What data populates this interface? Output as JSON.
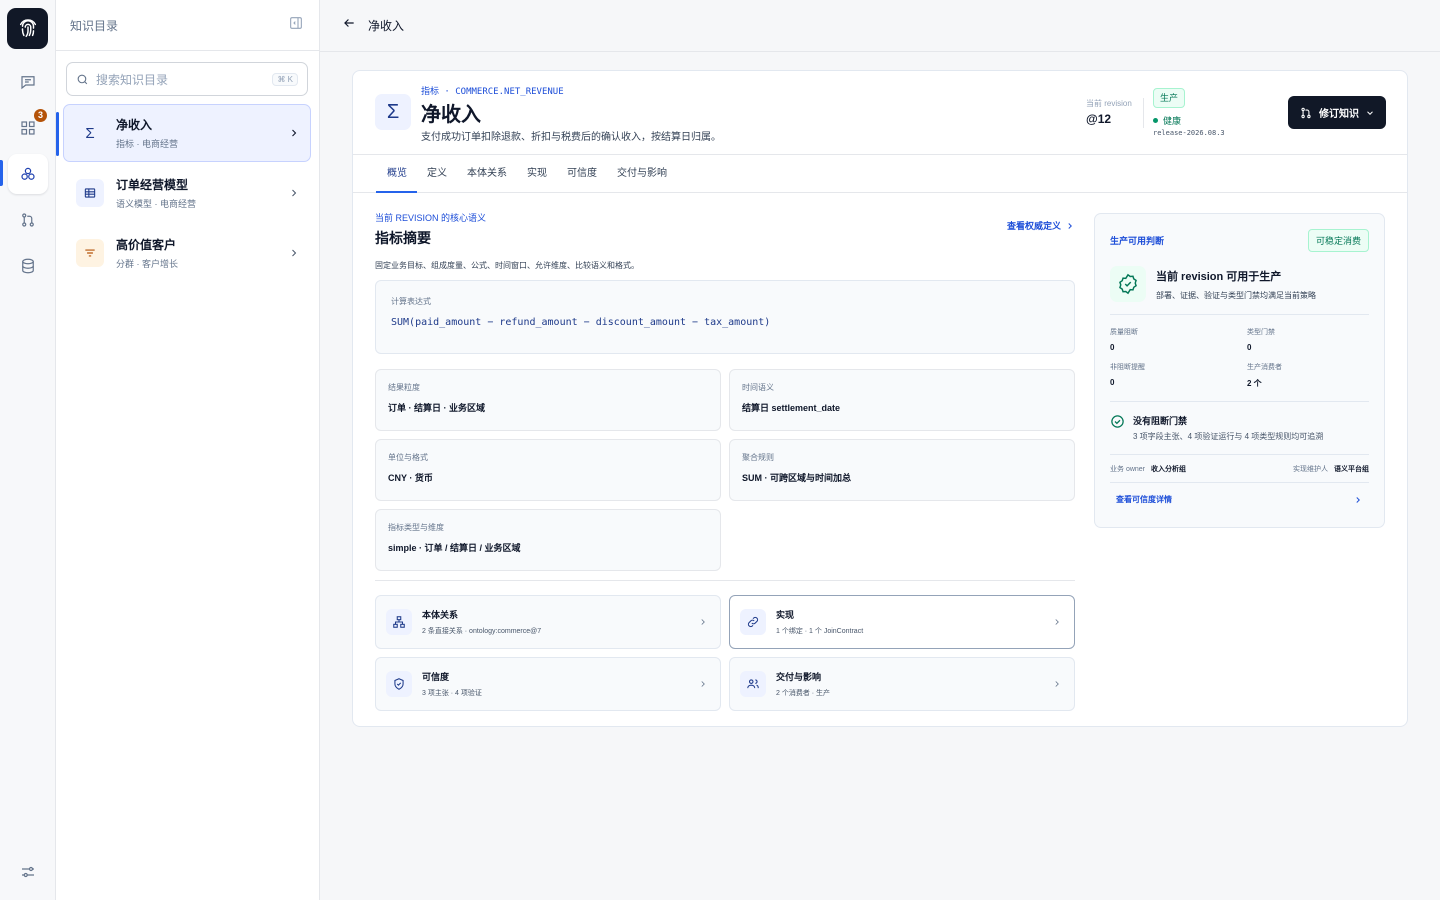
{
  "colors": {
    "accent": "#2563eb",
    "dark": "#111827",
    "success": "#047857",
    "warning": "#b45309"
  },
  "rail": {
    "badge_count": "3",
    "icons": [
      "fingerprint-icon",
      "chat-icon",
      "dashboard-icon",
      "ontology-icon",
      "git-branch-icon",
      "database-icon",
      "settings-sliders-icon"
    ]
  },
  "sidebar": {
    "title": "知识目录",
    "search_placeholder": "搜索知识目录",
    "search_shortcut": "⌘ K",
    "items": [
      {
        "name": "净收入",
        "sub": "指标 · 电商经营",
        "icon": "sigma-icon",
        "active": true
      },
      {
        "name": "订单经营模型",
        "sub": "语义模型 · 电商经营",
        "icon": "table-icon",
        "active": false
      },
      {
        "name": "高价值客户",
        "sub": "分群 · 客户增长",
        "icon": "filter-icon",
        "active": false
      }
    ]
  },
  "topbar": {
    "title": "净收入"
  },
  "header": {
    "eyebrow": "指标 · COMMERCE.NET_REVENUE",
    "title": "净收入",
    "description": "支付成功订单扣除退款、折扣与税费后的确认收入，按结算日归属。",
    "revision_label": "当前 revision",
    "revision_value": "@12",
    "env_pill": "生产",
    "health": "健康",
    "release": "release-2026.08.3",
    "revise_button": "修订知识"
  },
  "tabs": [
    "概览",
    "定义",
    "本体关系",
    "实现",
    "可信度",
    "交付与影响"
  ],
  "summary": {
    "kicker": "当前 REVISION 的核心语义",
    "title": "指标摘要",
    "authority_link": "查看权威定义",
    "description": "固定业务目标、组成度量、公式、时间窗口、允许维度、比较语义和格式。",
    "expression_label": "计算表达式",
    "expression": "SUM(paid_amount − refund_amount − discount_amount − tax_amount)",
    "fields": [
      {
        "label": "结果粒度",
        "value": "订单 · 结算日 · 业务区域"
      },
      {
        "label": "时间语义",
        "value": "结算日 settlement_date"
      },
      {
        "label": "单位与格式",
        "value": "CNY · 货币"
      },
      {
        "label": "聚合规则",
        "value": "SUM · 可跨区域与时间加总"
      },
      {
        "label": "指标类型与维度",
        "value": "simple · 订单 / 结算日 / 业务区域"
      }
    ],
    "links": [
      {
        "title": "本体关系",
        "sub": "2 条直接关系 · ontology:commerce@7",
        "icon": "hierarchy-icon"
      },
      {
        "title": "实现",
        "sub": "1 个绑定 · 1 个 JoinContract",
        "icon": "link-icon"
      },
      {
        "title": "可信度",
        "sub": "3 项主张 · 4 项验证",
        "icon": "shield-check-icon"
      },
      {
        "title": "交付与影响",
        "sub": "2 个消费者 · 生产",
        "icon": "users-icon"
      }
    ]
  },
  "panel": {
    "title": "生产可用判断",
    "pill": "可稳定消费",
    "status_title": "当前 revision 可用于生产",
    "status_sub": "部署、证据、验证与类型门禁均满足当前策略",
    "stats": [
      {
        "label": "质量阻断",
        "value": "0"
      },
      {
        "label": "类型门禁",
        "value": "0"
      },
      {
        "label": "非阻断提醒",
        "value": "0"
      },
      {
        "label": "生产消费者",
        "value": "2 个"
      }
    ],
    "gate_title": "没有阻断门禁",
    "gate_sub": "3 项字段主张、4 项验证运行与 4 项类型规则均可追溯",
    "owner_label": "业务 owner",
    "owner_value": "收入分析组",
    "maintainer_label": "实现维护人",
    "maintainer_value": "语义平台组",
    "detail_link": "查看可信度详情"
  }
}
